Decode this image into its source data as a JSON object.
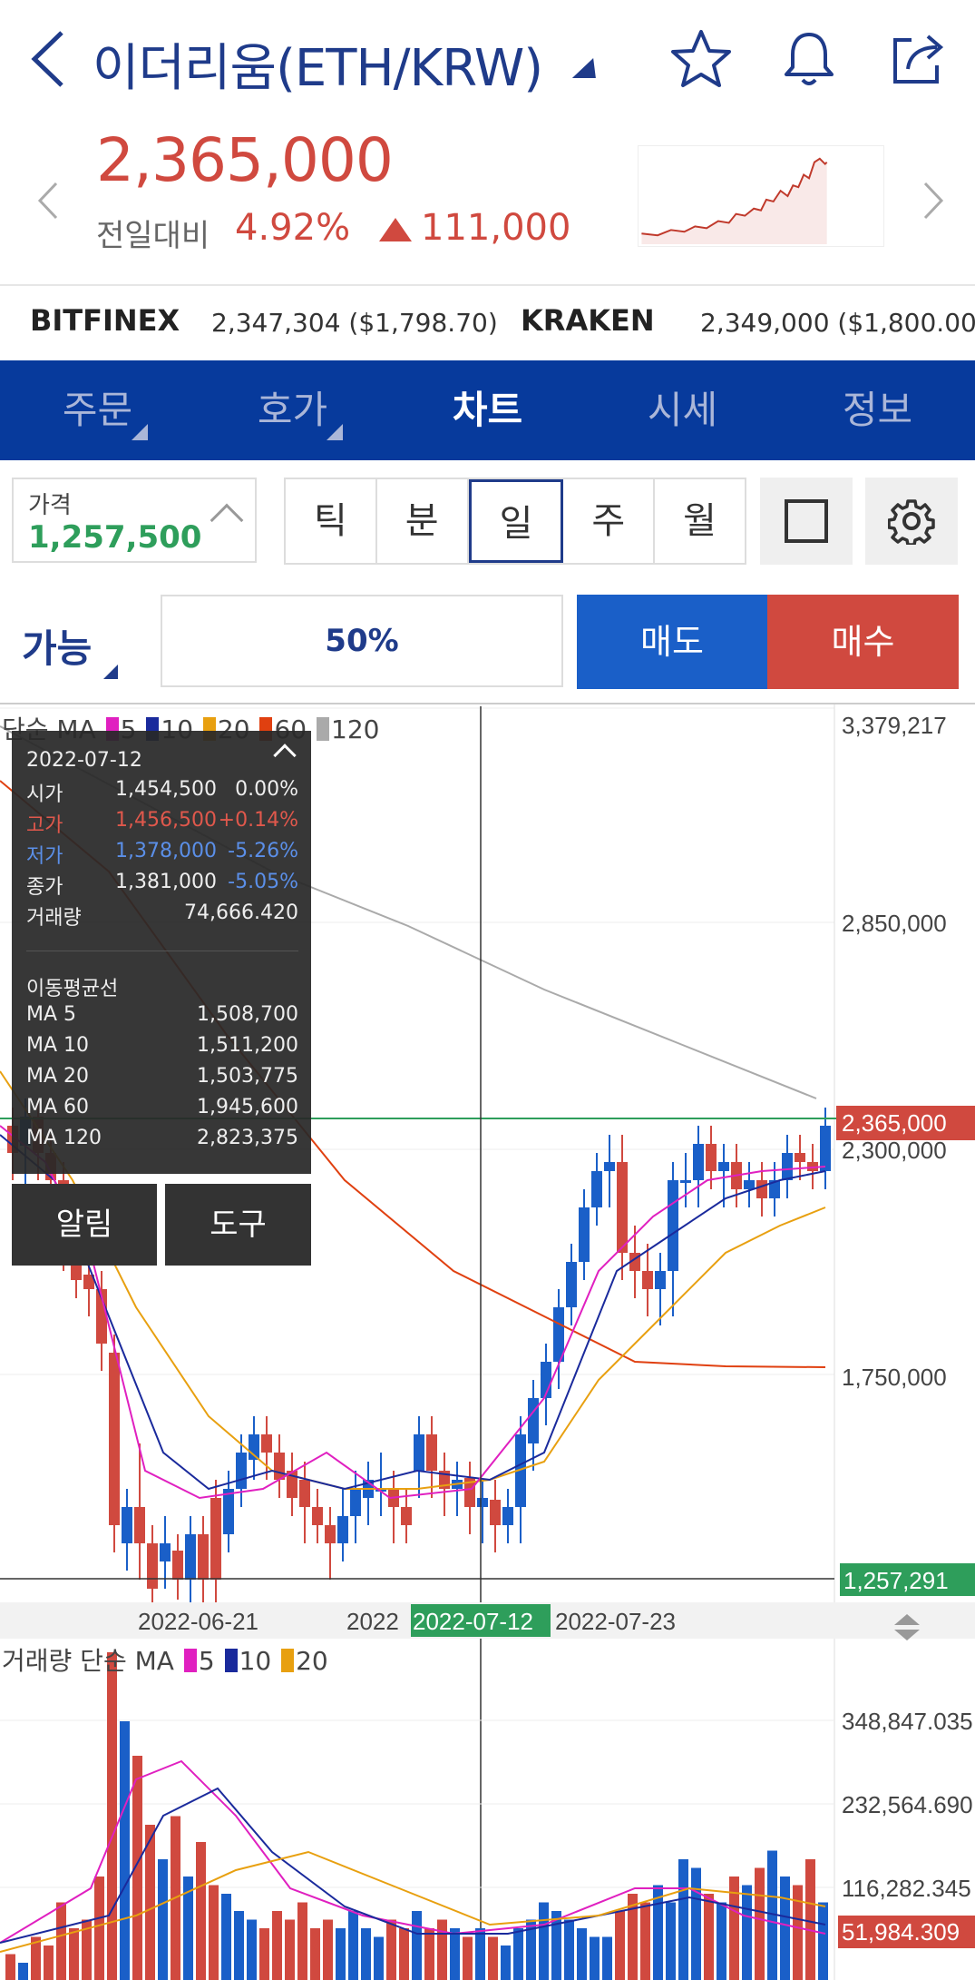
{
  "header": {
    "title": "이더리움(ETH/KRW)",
    "back_icon": "chevron-left-icon",
    "star_icon": "star-icon",
    "bell_icon": "bell-icon",
    "share_icon": "share-icon"
  },
  "quote": {
    "price": "2,365,000",
    "change_label": "전일대비",
    "change_pct": "4.92%",
    "change_amount": "111,000",
    "direction": "up",
    "up_color": "#d0493f"
  },
  "exchanges": [
    {
      "name": "BITFINEX",
      "value": "2,347,304 ($1,798.70)"
    },
    {
      "name": "KRAKEN",
      "value": "2,349,000 ($1,800.00)"
    }
  ],
  "tabs": [
    {
      "label": "주문",
      "active": false
    },
    {
      "label": "호가",
      "active": false
    },
    {
      "label": "차트",
      "active": true
    },
    {
      "label": "시세",
      "active": false
    },
    {
      "label": "정보",
      "active": false
    }
  ],
  "controls": {
    "price_label": "가격",
    "price_value": "1,257,500",
    "periods": [
      "틱",
      "분",
      "일",
      "주",
      "월"
    ],
    "selected_period": "일",
    "possible_label": "가능",
    "percent": "50%",
    "sell_label": "매도",
    "buy_label": "매수"
  },
  "chart_legend": {
    "label": "단순 MA",
    "items": [
      {
        "period": "5",
        "color": "#e020c0"
      },
      {
        "period": "10",
        "color": "#1a2a9c"
      },
      {
        "period": "20",
        "color": "#e8a010"
      },
      {
        "period": "60",
        "color": "#e04010"
      },
      {
        "period": "120",
        "color": "#aaaaaa"
      }
    ]
  },
  "volume_legend": {
    "label": "거래량 단순 MA",
    "items": [
      {
        "period": "5",
        "color": "#e020c0"
      },
      {
        "period": "10",
        "color": "#1a2a9c"
      },
      {
        "period": "20",
        "color": "#e8a010"
      }
    ]
  },
  "tooltip": {
    "date": "2022-07-12",
    "rows": [
      {
        "label": "시가",
        "value": "1,454,500",
        "pct": "0.00%",
        "color": "#eeeeee"
      },
      {
        "label": "고가",
        "value": "1,456,500",
        "pct": "+0.14%",
        "color": "#e0584c"
      },
      {
        "label": "저가",
        "value": "1,378,000",
        "pct": "-5.26%",
        "color": "#5b8fe8"
      },
      {
        "label": "종가",
        "value": "1,381,000",
        "pct": "-5.05%",
        "color": "#5b8fe8"
      },
      {
        "label": "거래량",
        "value": "74,666.420",
        "pct": "",
        "color": "#eeeeee"
      }
    ],
    "ma_title": "이동평균선",
    "ma_rows": [
      {
        "label": "MA 5",
        "value": "1,508,700"
      },
      {
        "label": "MA 10",
        "value": "1,511,200"
      },
      {
        "label": "MA 20",
        "value": "1,503,775"
      },
      {
        "label": "MA 60",
        "value": "1,945,600"
      },
      {
        "label": "MA 120",
        "value": "2,823,375"
      }
    ],
    "alarm_button": "알림",
    "tools_button": "도구"
  },
  "chart_data": {
    "type": "candlestick",
    "price_axis_labels": [
      "3,379,217",
      "2,850,000",
      "2,300,000",
      "1,750,000"
    ],
    "current_price_label": "2,365,000",
    "crosshair_price_label": "1,257,291",
    "date_labels": [
      "2022-06-21",
      "2022",
      "2022-07-12",
      "2022-07-23"
    ],
    "crosshair_date": "2022-07-12",
    "volume_axis_labels": [
      "348,847.035",
      "232,564.690",
      "116,282.345"
    ],
    "current_volume_label": "51,984.309",
    "up_color": "#d0493f",
    "down_color": "#1a5fc8"
  }
}
